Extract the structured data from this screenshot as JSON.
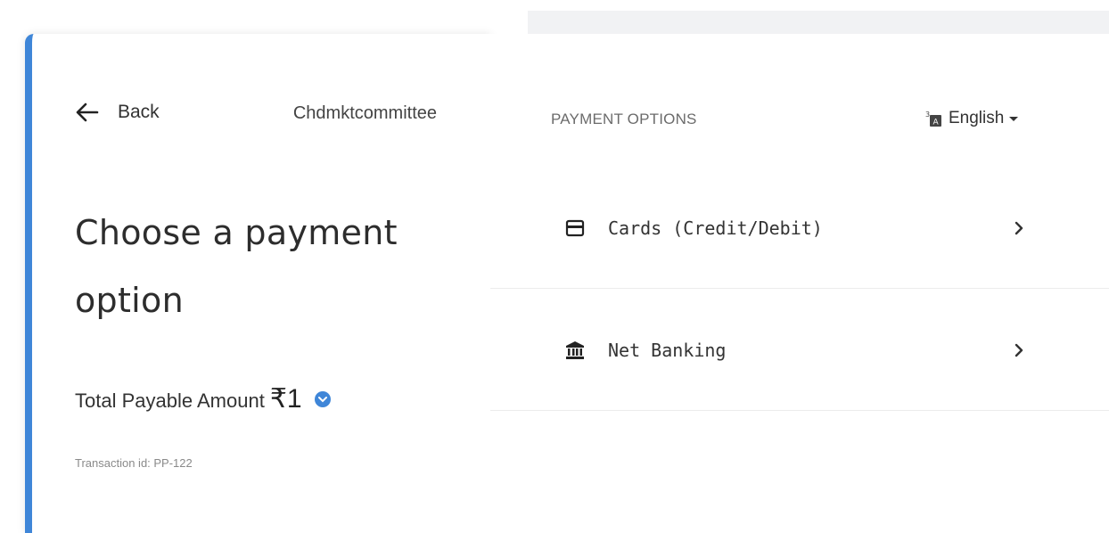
{
  "header": {
    "back_label": "Back",
    "merchant": "Chdmktcommittee"
  },
  "left": {
    "title": "Choose a payment option",
    "amount_label": "Total Payable Amount",
    "amount_value": "₹1",
    "transaction": "Transaction id: PP-122"
  },
  "right": {
    "section_title": "PAYMENT OPTIONS",
    "language": "English",
    "options": [
      {
        "label": "Cards (Credit/Debit)",
        "icon": "card-icon"
      },
      {
        "label": "Net Banking",
        "icon": "bank-icon"
      }
    ]
  },
  "colors": {
    "accent": "#3f86d8",
    "text": "#2b2b2b",
    "muted": "#8a8a8a"
  }
}
